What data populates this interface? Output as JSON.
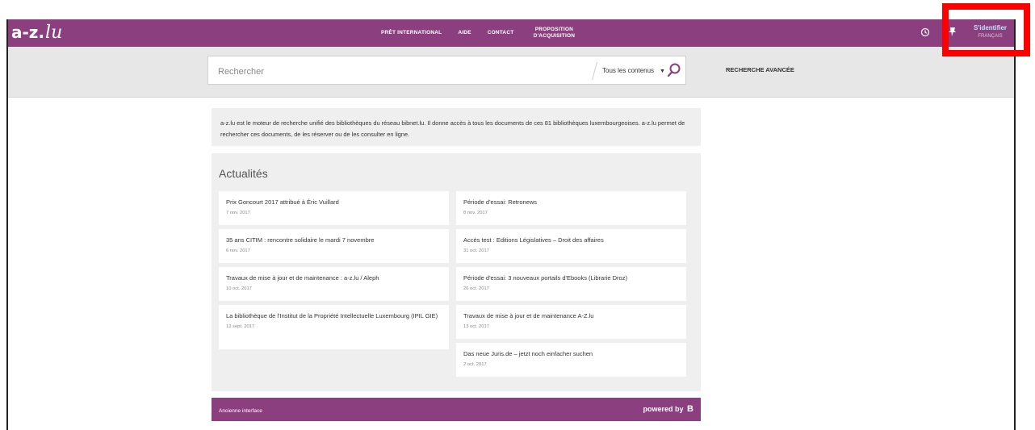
{
  "header": {
    "logo_text": "a-z",
    "logo_suffix": "lu",
    "nav": [
      {
        "label": "PRÊT INTERNATIONAL"
      },
      {
        "label": "AIDE"
      },
      {
        "label": "CONTACT"
      },
      {
        "label": "PROPOSITION D'ACQUISITION"
      }
    ],
    "login_label": "S'identifier",
    "language_label": "FRANÇAIS"
  },
  "search": {
    "placeholder": "Rechercher",
    "scope_label": "Tous les contenus",
    "advanced_label": "RECHERCHE AVANCÉE"
  },
  "intro": {
    "text": "a-z.lu est le moteur de recherche unifié des bibliothèques du réseau bibnet.lu. Il donne accès à tous les documents de ces 81 bibliothèques luxembourgeoises. a-z.lu permet de rechercher ces documents, de les réserver ou de les consulter en ligne."
  },
  "news": {
    "title": "Actualités",
    "left": [
      {
        "title": "Prix Goncourt 2017 attribué à Éric Vuillard",
        "date": "7 nov. 2017"
      },
      {
        "title": "35 ans CITIM : rencontre solidaire le mardi 7 novembre",
        "date": "6 nov. 2017"
      },
      {
        "title": "Travaux de mise à jour et de maintenance : a-z.lu / Aleph",
        "date": "10 oct. 2017"
      },
      {
        "title": "La bibliothèque de l'Institut de la Propriété Intellectuelle Luxembourg (IPIL GIE)",
        "date": "13 sept. 2017"
      }
    ],
    "right": [
      {
        "title": "Période d'essai: Retronews",
        "date": "8 nov. 2017"
      },
      {
        "title": "Accès test : Editions Législatives – Droit des affaires",
        "date": "31 oct. 2017"
      },
      {
        "title": "Période d'essai: 3 nouveaux portails d'Ebooks (Librarie Droz)",
        "date": "26 oct. 2017"
      },
      {
        "title": "Travaux de mise à jour et de maintenance A-Z.lu",
        "date": "13 oct. 2017"
      },
      {
        "title": "Das neue Juris.de – jetzt noch einfacher suchen",
        "date": "2 oct. 2017"
      }
    ]
  },
  "footer": {
    "old_interface_label": "Ancienne interface",
    "powered_label": "powered by",
    "powered_brand": "B"
  },
  "icons": {
    "history": "history-icon",
    "pin": "pin-icon",
    "search": "search-icon"
  },
  "colors": {
    "brand": "#8c3f7f",
    "highlight": "#ff0000",
    "login_text": "#bfe3ff"
  }
}
